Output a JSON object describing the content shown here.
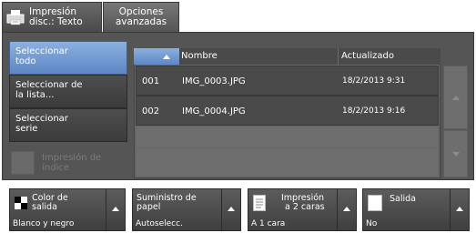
{
  "tabs": {
    "tab1_line1": "Impresión",
    "tab1_line2": "disc.: Texto",
    "tab2_line1": "Opciones",
    "tab2_line2": "avanzadas"
  },
  "left_menu": {
    "select_all_l1": "Seleccionar",
    "select_all_l2": "todo",
    "select_list_l1": "Seleccionar de",
    "select_list_l2": "la lista...",
    "select_series_l1": "Seleccionar",
    "select_series_l2": "serie",
    "index_print_l1": "Impresión de",
    "index_print_l2": "índice"
  },
  "table": {
    "col_name": "Nombre",
    "col_updated": "Actualizado",
    "rows": [
      {
        "num": "001",
        "name": "IMG_0003.JPG",
        "date": "18/2/2013 9:31"
      },
      {
        "num": "002",
        "name": "IMG_0004.JPG",
        "date": "18/2/2013 9:16"
      }
    ]
  },
  "bottom": {
    "color_l1": "Color de",
    "color_l2": "salida",
    "color_val": "Blanco y negro",
    "paper_l1": "Suministro de",
    "paper_l2": "papel",
    "paper_val": "Autoselecc.",
    "duplex_l1": "Impresión",
    "duplex_l2": "a 2 caras",
    "duplex_val": "A 1 cara",
    "output_l1": "Salida",
    "output_val": "No"
  },
  "colors": {
    "accent_blue": "#6b93cf",
    "panel": "#555555",
    "row_bg": "#4a4a4a"
  }
}
